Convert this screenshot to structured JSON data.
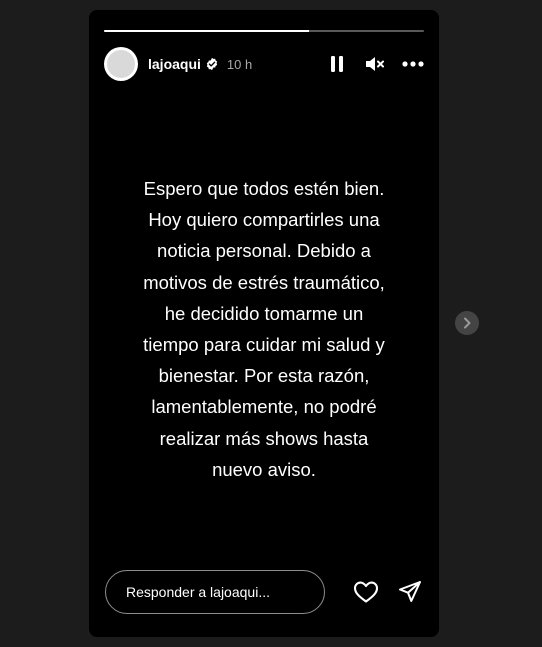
{
  "story": {
    "progress_fraction": 0.64,
    "user": {
      "username": "lajoaqui",
      "time_ago": "10 h",
      "verified_icon": "verified-badge-icon"
    },
    "controls": {
      "pause_icon": "pause-icon",
      "mute_icon": "speaker-muted-icon",
      "more_icon": "more-options-icon"
    },
    "text": "Espero que todos estén bien.\nHoy quiero compartirles una\nnoticia personal. Debido a\nmotivos de estrés traumático,\nhe decidido tomarme un\ntiempo para cuidar mi salud y\nbienestar. Por esta razón,\nlamentablemente, no podré\nrealizar más shows hasta\nnuevo aviso.",
    "reply": {
      "placeholder": "Responder a lajoaqui...",
      "like_icon": "heart-icon",
      "share_icon": "send-icon"
    }
  },
  "navigation": {
    "next_icon": "chevron-right-icon"
  },
  "colors": {
    "page_background": "#1c1c1c",
    "story_background": "#000000",
    "text": "#ffffff",
    "secondary_text": "#a8a8a8"
  }
}
